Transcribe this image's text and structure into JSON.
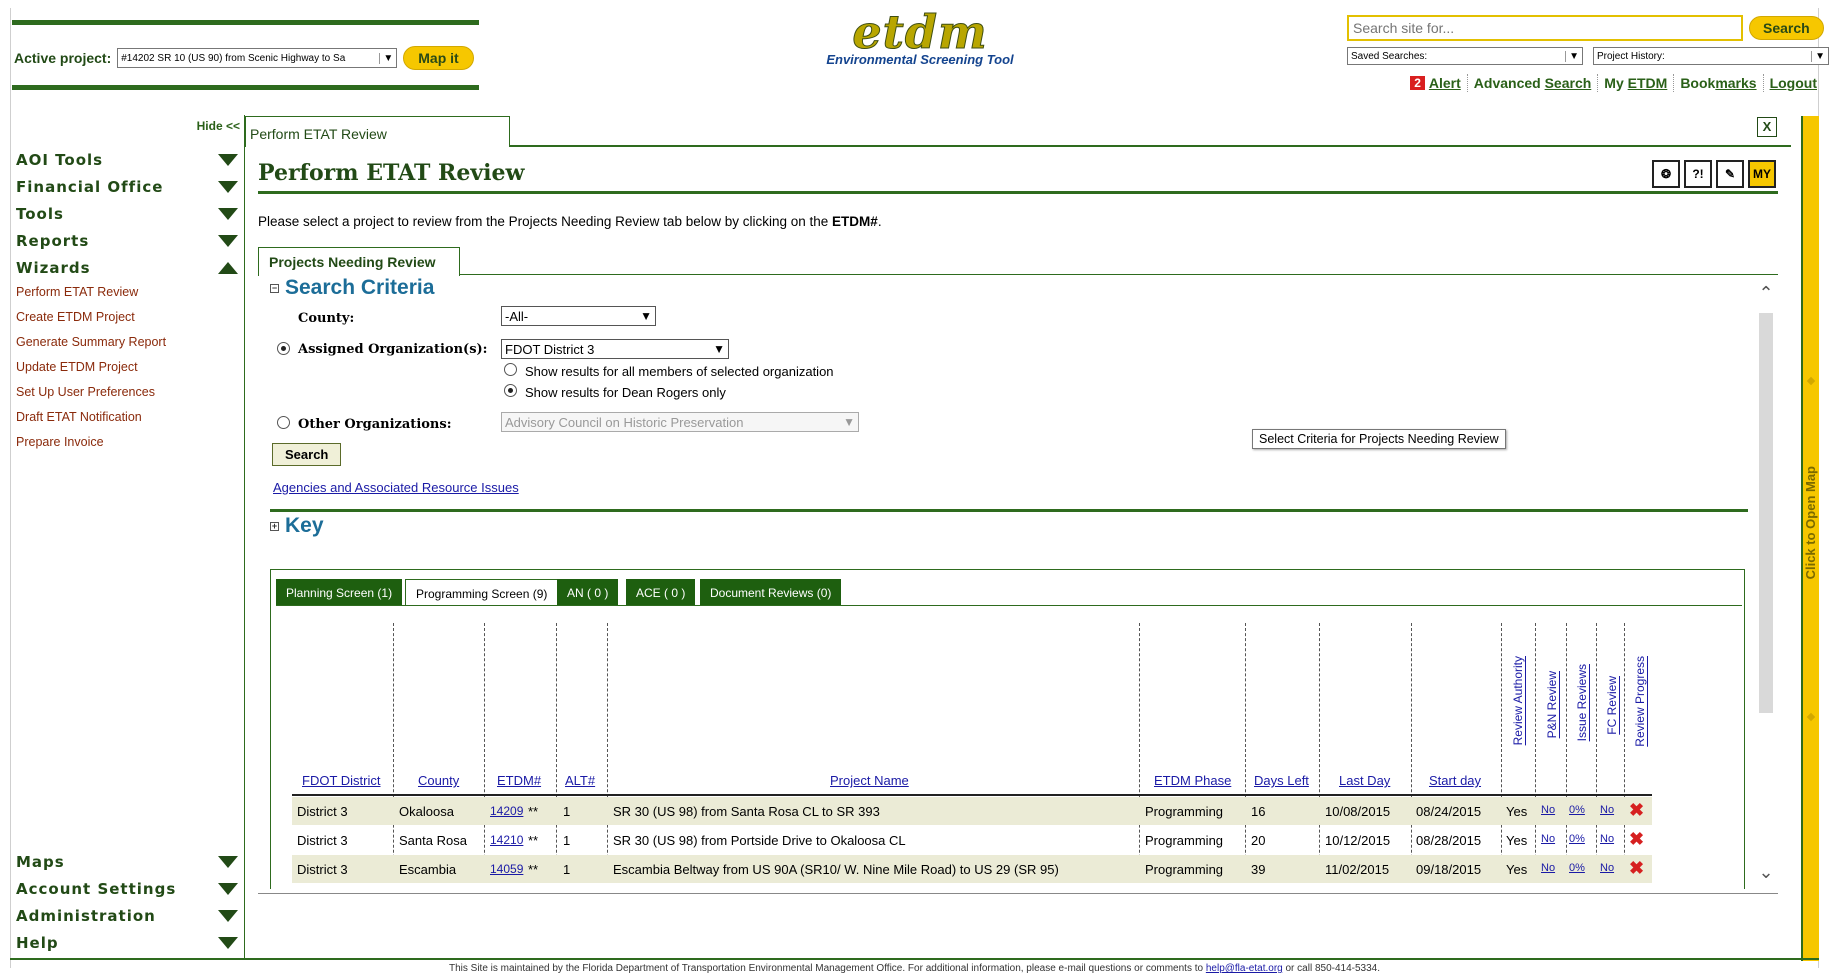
{
  "header": {
    "active_project_label": "Active project:",
    "active_project_value": "#14202 SR 10 (US 90) from Scenic Highway to Sa",
    "map_it": "Map it",
    "logo_main": "etdm",
    "logo_sub": "Environmental Screening Tool",
    "search_placeholder": "Search site for...",
    "search_button": "Search",
    "saved_searches": "Saved Searches:",
    "project_history": "Project History:",
    "alert_count": "2",
    "alert": "Alert",
    "advanced_pre": "Advanced ",
    "advanced_search": "Search",
    "my_pre": "My ",
    "my_etdm": "ETDM",
    "book_pre": "Book",
    "book_marks": "marks",
    "logout": "Logout"
  },
  "sidebar": {
    "hide": "Hide <<",
    "sections_top": [
      "AOI Tools",
      "Financial Office",
      "Tools",
      "Reports"
    ],
    "wizards_label": "Wizards",
    "wizard_items": [
      "Perform ETAT Review",
      "Create ETDM Project",
      "Generate Summary Report",
      "Update ETDM Project",
      "Set Up User Preferences",
      "Draft ETAT Notification",
      "Prepare Invoice"
    ],
    "sections_bottom": [
      "Maps",
      "Account Settings",
      "Administration",
      "Help"
    ]
  },
  "main": {
    "tab_title": "Perform ETAT Review",
    "close": "X",
    "page_title": "Perform ETAT Review",
    "instruction_pre": "Please select a project to review from the Projects Needing Review tab below by clicking on the ",
    "instruction_bold": "ETDM#",
    "instruction_post": ".",
    "tool_icons": [
      "map-icon",
      "help-icon",
      "notes-icon",
      "my-etdm-icon"
    ],
    "tool_icon_glyphs": [
      "❂",
      "?!",
      "✎",
      "MY"
    ],
    "inner_tab": "Projects Needing Review",
    "search_criteria": {
      "title": "Search Criteria",
      "county_label": "County:",
      "county_value": "-All-",
      "assigned_label": "Assigned Organization(s):",
      "assigned_value": "FDOT District 3",
      "opt_all": "Show results for all members of selected organization",
      "opt_user": "Show results for Dean Rogers only",
      "other_label": "Other Organizations:",
      "other_value": "Advisory Council on Historic Preservation",
      "search_button": "Search",
      "agencies_link": "Agencies and Associated Resource Issues",
      "tooltip": "Select Criteria for Projects Needing Review"
    },
    "key_title": "Key",
    "result_tabs": [
      "Planning Screen (1)",
      "Programming Screen (9)",
      "AN ( 0 )",
      "ACE ( 0 )",
      "Document Reviews (0)"
    ],
    "table": {
      "columns": [
        "FDOT District",
        "County",
        "ETDM#",
        "ALT#",
        "Project Name",
        "ETDM Phase",
        "Days Left",
        "Last Day",
        "Start day"
      ],
      "vertical_columns": [
        "Review Authority",
        "P&N Review",
        "Issue Reviews",
        "FC Review",
        "Review Progress"
      ],
      "rows": [
        {
          "district": "District 3",
          "county": "Okaloosa",
          "etdm": "14209",
          "stars": "**",
          "alt": "1",
          "name": "SR 30 (US 98) from Santa Rosa CL to SR 393",
          "phase": "Programming",
          "days": "16",
          "last": "10/08/2015",
          "start": "08/24/2015",
          "authority": "Yes",
          "pn": "No",
          "issue": "0%",
          "fc": "No",
          "progress": "✖"
        },
        {
          "district": "District 3",
          "county": "Santa Rosa",
          "etdm": "14210",
          "stars": "**",
          "alt": "1",
          "name": "SR 30 (US 98) from Portside Drive to Okaloosa CL",
          "phase": "Programming",
          "days": "20",
          "last": "10/12/2015",
          "start": "08/28/2015",
          "authority": "Yes",
          "pn": "No",
          "issue": "0%",
          "fc": "No",
          "progress": "✖"
        },
        {
          "district": "District 3",
          "county": "Escambia",
          "etdm": "14059",
          "stars": "**",
          "alt": "1",
          "name": "Escambia Beltway from US 90A (SR10/ W. Nine Mile Road) to US 29 (SR 95)",
          "phase": "Programming",
          "days": "39",
          "last": "11/02/2015",
          "start": "09/18/2015",
          "authority": "Yes",
          "pn": "No",
          "issue": "0%",
          "fc": "No",
          "progress": "✖"
        }
      ]
    },
    "map_rail": "Click to Open Map"
  },
  "footer": {
    "text_pre": "This Site is maintained by the Florida Department of Transportation Environmental Management Office. For additional information, please e-mail questions or comments to ",
    "email": "help@fla-etat.org",
    "text_post": " or call 850-414-5334."
  },
  "colors": {
    "brand_green": "#2e6b1e",
    "accent_yellow": "#f6c700",
    "link_blue": "#1a1aa6",
    "heading_blue": "#1c6d98",
    "alert_red": "#d91f1f"
  }
}
